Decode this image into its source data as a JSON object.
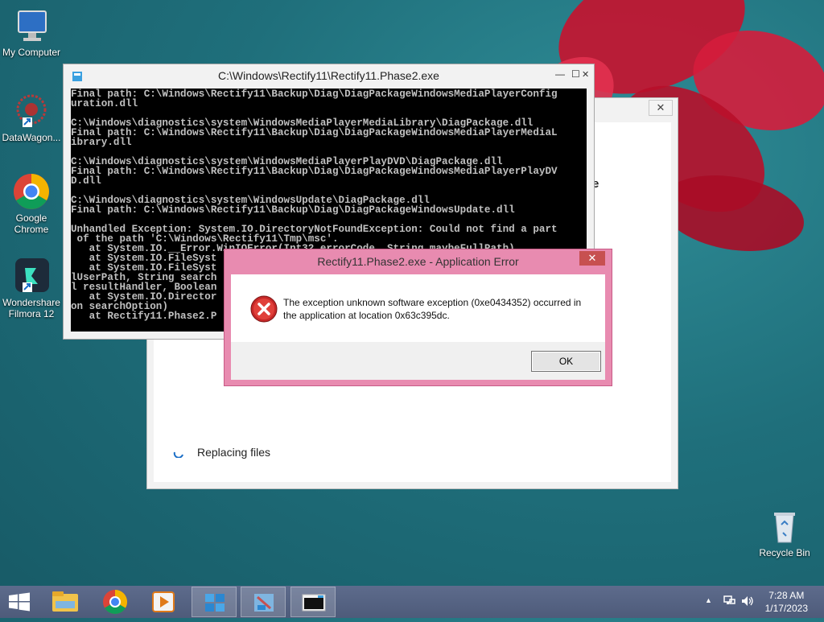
{
  "desktop": {
    "icons": [
      {
        "label": "My Computer"
      },
      {
        "label": "DataWagon..."
      },
      {
        "label": "Google Chrome"
      },
      {
        "label": "Wondershare Filmora 12"
      },
      {
        "label": "Recycle Bin"
      }
    ]
  },
  "background_window": {
    "status_text": "Replacing files",
    "partial_text": "e",
    "close_glyph": "✕"
  },
  "console": {
    "title": "C:\\Windows\\Rectify11\\Rectify11.Phase2.exe",
    "lines": [
      "Final path: C:\\Windows\\Rectify11\\Backup\\Diag\\DiagPackageWindowsMediaPlayerConfig",
      "uration.dll",
      "",
      "C:\\Windows\\diagnostics\\system\\WindowsMediaPlayerMediaLibrary\\DiagPackage.dll",
      "Final path: C:\\Windows\\Rectify11\\Backup\\Diag\\DiagPackageWindowsMediaPlayerMediaL",
      "ibrary.dll",
      "",
      "C:\\Windows\\diagnostics\\system\\WindowsMediaPlayerPlayDVD\\DiagPackage.dll",
      "Final path: C:\\Windows\\Rectify11\\Backup\\Diag\\DiagPackageWindowsMediaPlayerPlayDV",
      "D.dll",
      "",
      "C:\\Windows\\diagnostics\\system\\WindowsUpdate\\DiagPackage.dll",
      "Final path: C:\\Windows\\Rectify11\\Backup\\Diag\\DiagPackageWindowsUpdate.dll",
      "",
      "Unhandled Exception: System.IO.DirectoryNotFoundException: Could not find a part",
      " of the path 'C:\\Windows\\Rectify11\\Tmp\\msc'.",
      "   at System.IO.__Error.WinIOError(Int32 errorCode, String maybeFullPath)",
      "   at System.IO.FileSyst",
      "   at System.IO.FileSyst",
      "lUserPath, String search",
      "l resultHandler, Boolean",
      "   at System.IO.Director",
      "on searchOption)",
      "   at Rectify11.Phase2.P"
    ],
    "minimize_glyph": "—",
    "maximize_glyph": "☐",
    "close_glyph": "✕"
  },
  "error_dialog": {
    "title": "Rectify11.Phase2.exe - Application Error",
    "message": "The exception unknown software exception (0xe0434352) occurred in the application at location 0x63c395dc.",
    "ok_label": "OK",
    "close_glyph": "✕",
    "icon": "error-icon"
  },
  "taskbar": {
    "time": "7:28 AM",
    "date": "1/17/2023",
    "tray_expand_glyph": "▲",
    "items": [
      "start",
      "file-explorer",
      "chrome",
      "media-player",
      "installer",
      "rectify-app",
      "console"
    ]
  },
  "colors": {
    "error_red": "#c62828",
    "dialog_frame": "#e88bb0",
    "taskbar": "#56637f"
  }
}
